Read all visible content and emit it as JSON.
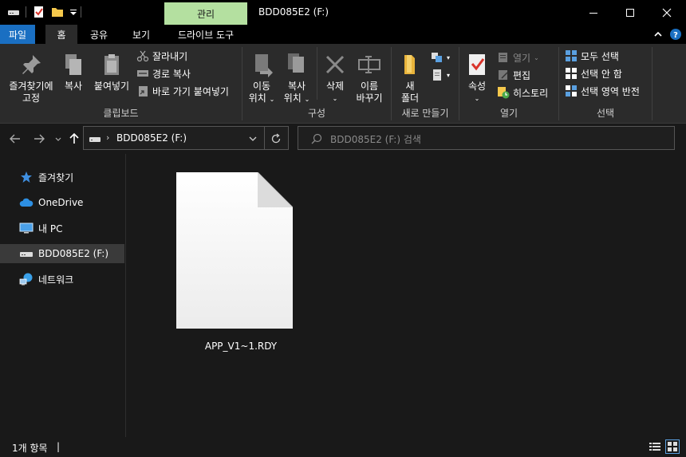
{
  "titlebar": {
    "context_tab": "관리",
    "window_title": "BDD085E2 (F:)"
  },
  "ribbon_tabs": {
    "file": "파일",
    "home": "홈",
    "share": "공유",
    "view": "보기",
    "drive_tools": "드라이브 도구"
  },
  "clipboard": {
    "pin_line1": "즐겨찾기에",
    "pin_line2": "고정",
    "copy": "복사",
    "paste": "붙여넣기",
    "cut": "잘라내기",
    "copy_path": "경로 복사",
    "paste_shortcut": "바로 가기 붙여넣기",
    "group": "클립보드"
  },
  "organize": {
    "move_line1": "이동",
    "move_line2": "위치",
    "copyto_line1": "복사",
    "copyto_line2": "위치",
    "delete": "삭제",
    "rename_line1": "이름",
    "rename_line2": "바꾸기",
    "group": "구성"
  },
  "new": {
    "folder_line1": "새",
    "folder_line2": "폴더",
    "group": "새로 만들기"
  },
  "open": {
    "properties": "속성",
    "open": "열기",
    "edit": "편집",
    "history": "히스토리",
    "group": "열기"
  },
  "select": {
    "select_all": "모두 선택",
    "select_none": "선택 안 함",
    "invert": "선택 영역 반전",
    "group": "선택"
  },
  "address": {
    "path": "BDD085E2 (F:)",
    "search_placeholder": "BDD085E2 (F:) 검색"
  },
  "nav": {
    "quick_access": "즐겨찾기",
    "onedrive": "OneDrive",
    "this_pc": "내 PC",
    "drive": "BDD085E2 (F:)",
    "network": "네트워크"
  },
  "files": [
    {
      "name": "APP_V1~1.RDY"
    }
  ],
  "status": {
    "item_count": "1개 항목",
    "caret": "|"
  },
  "colors": {
    "file_tab": "#1a6fc2",
    "manage_tab": "#b4e0a0",
    "background": "#191919",
    "ribbon": "#2b2b2b",
    "selected_nav": "#3a3a3a"
  }
}
